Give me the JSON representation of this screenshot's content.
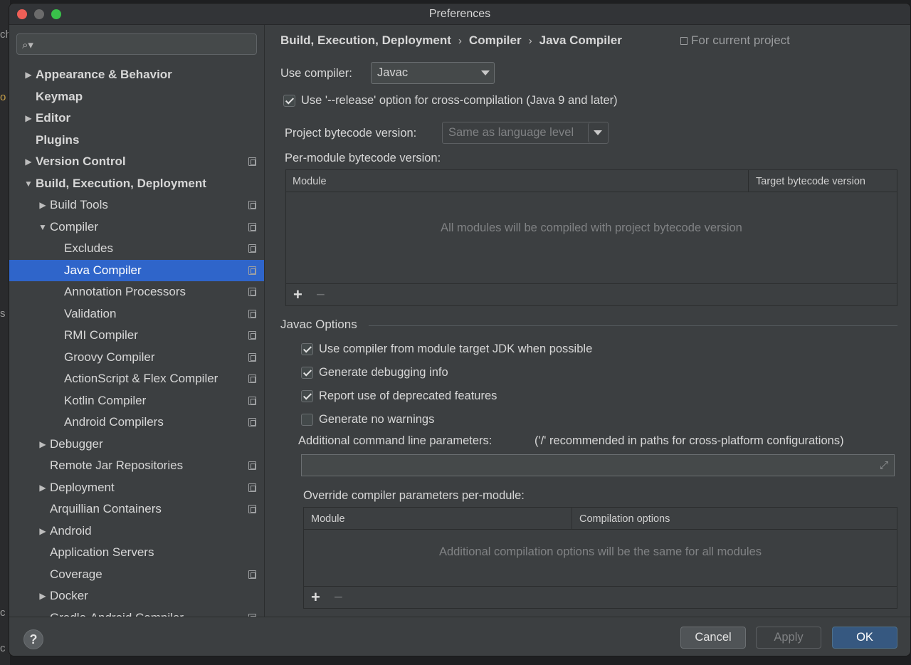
{
  "window": {
    "title": "Preferences"
  },
  "desktop": {
    "left_fragments": [
      "ch",
      "o",
      "s",
      "c",
      "c"
    ]
  },
  "sidebar": {
    "search": {
      "placeholder": ""
    },
    "items": [
      {
        "label": "Appearance & Behavior",
        "bold": true,
        "arrow": "right",
        "level": 0,
        "project": false
      },
      {
        "label": "Keymap",
        "bold": true,
        "arrow": "none",
        "level": 0,
        "project": false
      },
      {
        "label": "Editor",
        "bold": true,
        "arrow": "right",
        "level": 0,
        "project": false
      },
      {
        "label": "Plugins",
        "bold": true,
        "arrow": "none",
        "level": 0,
        "project": false
      },
      {
        "label": "Version Control",
        "bold": true,
        "arrow": "right",
        "level": 0,
        "project": true
      },
      {
        "label": "Build, Execution, Deployment",
        "bold": true,
        "arrow": "down",
        "level": 0,
        "project": false
      },
      {
        "label": "Build Tools",
        "bold": false,
        "arrow": "right",
        "level": 1,
        "project": true
      },
      {
        "label": "Compiler",
        "bold": false,
        "arrow": "down",
        "level": 1,
        "project": true
      },
      {
        "label": "Excludes",
        "bold": false,
        "arrow": "none",
        "level": 2,
        "project": true
      },
      {
        "label": "Java Compiler",
        "bold": false,
        "arrow": "none",
        "level": 2,
        "project": true,
        "selected": true
      },
      {
        "label": "Annotation Processors",
        "bold": false,
        "arrow": "none",
        "level": 2,
        "project": true
      },
      {
        "label": "Validation",
        "bold": false,
        "arrow": "none",
        "level": 2,
        "project": true
      },
      {
        "label": "RMI Compiler",
        "bold": false,
        "arrow": "none",
        "level": 2,
        "project": true
      },
      {
        "label": "Groovy Compiler",
        "bold": false,
        "arrow": "none",
        "level": 2,
        "project": true
      },
      {
        "label": "ActionScript & Flex Compiler",
        "bold": false,
        "arrow": "none",
        "level": 2,
        "project": true
      },
      {
        "label": "Kotlin Compiler",
        "bold": false,
        "arrow": "none",
        "level": 2,
        "project": true
      },
      {
        "label": "Android Compilers",
        "bold": false,
        "arrow": "none",
        "level": 2,
        "project": true
      },
      {
        "label": "Debugger",
        "bold": false,
        "arrow": "right",
        "level": 1,
        "project": false
      },
      {
        "label": "Remote Jar Repositories",
        "bold": false,
        "arrow": "none",
        "level": 1,
        "project": true
      },
      {
        "label": "Deployment",
        "bold": false,
        "arrow": "right",
        "level": 1,
        "project": true
      },
      {
        "label": "Arquillian Containers",
        "bold": false,
        "arrow": "none",
        "level": 1,
        "project": true
      },
      {
        "label": "Android",
        "bold": false,
        "arrow": "right",
        "level": 1,
        "project": false
      },
      {
        "label": "Application Servers",
        "bold": false,
        "arrow": "none",
        "level": 1,
        "project": false
      },
      {
        "label": "Coverage",
        "bold": false,
        "arrow": "none",
        "level": 1,
        "project": true
      },
      {
        "label": "Docker",
        "bold": false,
        "arrow": "right",
        "level": 1,
        "project": false
      },
      {
        "label": "Gradle-Android Compiler",
        "bold": false,
        "arrow": "none",
        "level": 1,
        "project": true
      }
    ]
  },
  "breadcrumb": {
    "items": [
      "Build, Execution, Deployment",
      "Compiler",
      "Java Compiler"
    ],
    "separator": "›",
    "scope": "For current project"
  },
  "compiler": {
    "use_label": "Use compiler:",
    "use_value": "Javac",
    "release_option": {
      "label": "Use '--release' option for cross-compilation (Java 9 and later)",
      "checked": true
    },
    "bytecode_label": "Project bytecode version:",
    "bytecode_value": "Same as language level",
    "per_module_label": "Per-module bytecode version:",
    "module_table": {
      "col_module": "Module",
      "col_target": "Target bytecode version",
      "empty": "All modules will be compiled with project bytecode version",
      "add": "+",
      "remove": "−"
    }
  },
  "javac": {
    "section": "Javac Options",
    "options": [
      {
        "label": "Use compiler from module target JDK when possible",
        "checked": true
      },
      {
        "label": "Generate debugging info",
        "checked": true
      },
      {
        "label": "Report use of deprecated features",
        "checked": true
      },
      {
        "label": "Generate no warnings",
        "checked": false
      }
    ],
    "cmd_label": "Additional command line parameters:",
    "cmd_hint": "('/' recommended in paths for cross-platform configurations)",
    "cmd_value": "",
    "override_label": "Override compiler parameters per-module:",
    "override_table": {
      "col_module": "Module",
      "col_options": "Compilation options",
      "empty": "Additional compilation options will be the same for all modules",
      "add": "+",
      "remove": "−"
    }
  },
  "footer": {
    "help": "?",
    "cancel": "Cancel",
    "apply": "Apply",
    "ok": "OK"
  },
  "colors": {
    "selection": "#2f65ca",
    "ok_button": "#365880",
    "panel": "#3c3f41"
  }
}
